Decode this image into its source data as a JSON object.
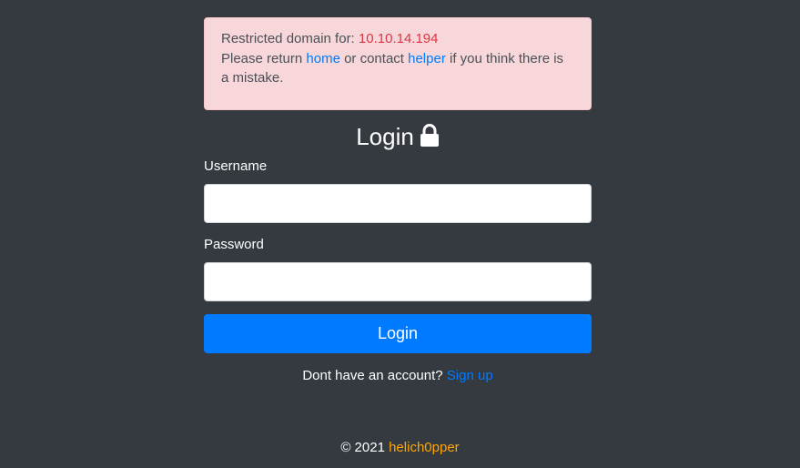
{
  "alert": {
    "restricted_prefix": "Restricted domain for: ",
    "ip": "10.10.14.194",
    "return_text": "Please return ",
    "home_link": "home",
    "contact_text": " or contact ",
    "helper_link": "helper",
    "mistake_text": " if you think there is a mistake."
  },
  "login": {
    "title": "Login",
    "username_label": "Username",
    "username_value": "",
    "password_label": "Password",
    "password_value": "",
    "submit_label": "Login",
    "lock_icon": "lock-icon"
  },
  "signup": {
    "prompt": "Dont have an account? ",
    "link": "Sign up"
  },
  "footer": {
    "copyright": "© 2021 ",
    "brand": "helich0pper"
  },
  "colors": {
    "background": "#343a40",
    "alert_bg": "#f8d7da",
    "ip": "#dc3545",
    "link": "#007bff",
    "button": "#007bff",
    "brand": "#ffa500"
  }
}
